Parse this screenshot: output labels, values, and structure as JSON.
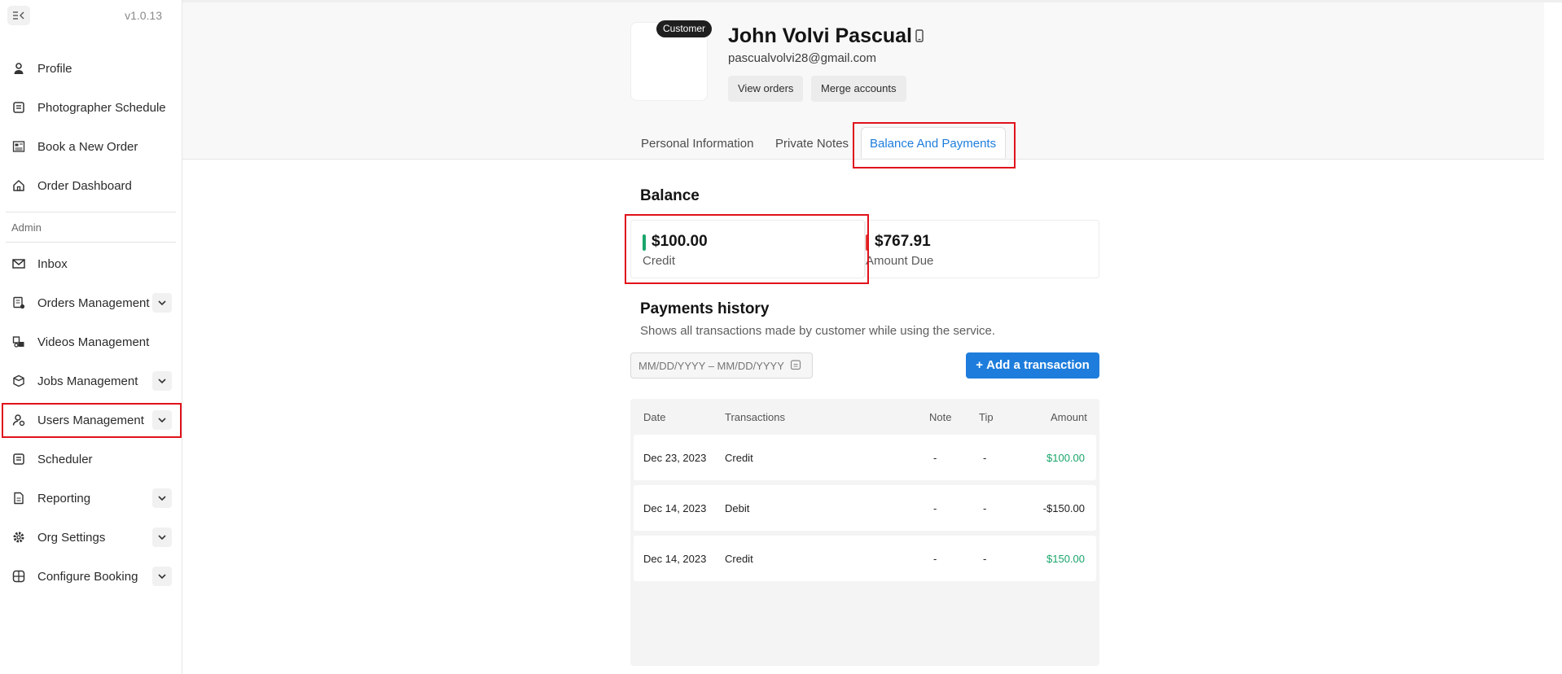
{
  "app": {
    "version": "v1.0.13"
  },
  "sidebar": {
    "items_top": [
      {
        "label": "Profile",
        "icon": "person-icon"
      },
      {
        "label": "Photographer Schedule",
        "icon": "calendar-list-icon"
      },
      {
        "label": "Book a New Order",
        "icon": "order-form-icon"
      },
      {
        "label": "Order Dashboard",
        "icon": "home-icon"
      }
    ],
    "section_label": "Admin",
    "items_admin": [
      {
        "label": "Inbox",
        "icon": "mail-icon"
      },
      {
        "label": "Orders Management",
        "icon": "orders-icon"
      },
      {
        "label": "Videos Management",
        "icon": "video-icon"
      },
      {
        "label": "Jobs Management",
        "icon": "box-icon"
      },
      {
        "label": "Users Management",
        "icon": "users-icon"
      },
      {
        "label": "Scheduler",
        "icon": "scheduler-icon"
      },
      {
        "label": "Reporting",
        "icon": "report-icon"
      },
      {
        "label": "Org Settings",
        "icon": "gear-icon"
      },
      {
        "label": "Configure Booking",
        "icon": "grid-icon"
      }
    ]
  },
  "profile": {
    "badge": "Customer",
    "name": "John Volvi Pascual",
    "email": "pascualvolvi28@gmail.com",
    "view_orders": "View orders",
    "merge_accounts": "Merge accounts"
  },
  "tabs": [
    "Personal Information",
    "Private Notes",
    "Balance And Payments"
  ],
  "balance": {
    "title": "Balance",
    "credit_amount": "$100.00",
    "credit_label": "Credit",
    "due_amount": "$767.91",
    "due_label": "Amount Due",
    "credit_color": "#1aa56b",
    "due_color": "#e53935"
  },
  "payments": {
    "title": "Payments history",
    "subtitle": "Shows all transactions made by customer while using the service.",
    "date_placeholder": "MM/DD/YYYY – MM/DD/YYYY",
    "add_button": "Add a transaction",
    "columns": [
      "Date",
      "Transactions",
      "Note",
      "Tip",
      "Amount"
    ],
    "rows": [
      {
        "date": "Dec 23, 2023",
        "type": "Credit",
        "note": "-",
        "tip": "-",
        "amount": "$100.00"
      },
      {
        "date": "Dec 14, 2023",
        "type": "Debit",
        "note": "-",
        "tip": "-",
        "amount": "-$150.00"
      },
      {
        "date": "Dec 14, 2023",
        "type": "Credit",
        "note": "-",
        "tip": "-",
        "amount": "$150.00"
      }
    ]
  }
}
